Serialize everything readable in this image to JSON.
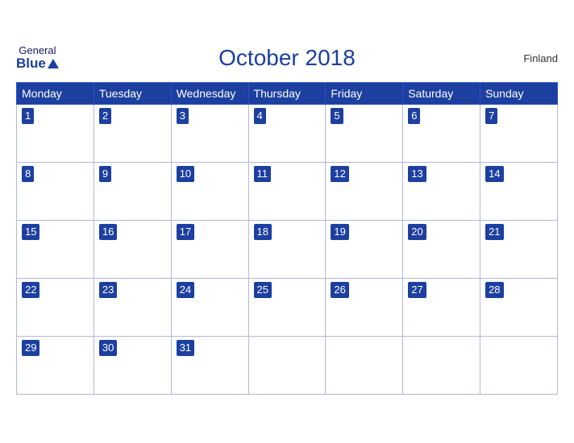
{
  "header": {
    "logo_general": "General",
    "logo_blue": "Blue",
    "title": "October 2018",
    "country": "Finland"
  },
  "weekdays": [
    "Monday",
    "Tuesday",
    "Wednesday",
    "Thursday",
    "Friday",
    "Saturday",
    "Sunday"
  ],
  "weeks": [
    [
      {
        "day": 1,
        "empty": false
      },
      {
        "day": 2,
        "empty": false
      },
      {
        "day": 3,
        "empty": false
      },
      {
        "day": 4,
        "empty": false
      },
      {
        "day": 5,
        "empty": false
      },
      {
        "day": 6,
        "empty": false
      },
      {
        "day": 7,
        "empty": false
      }
    ],
    [
      {
        "day": 8,
        "empty": false
      },
      {
        "day": 9,
        "empty": false
      },
      {
        "day": 10,
        "empty": false
      },
      {
        "day": 11,
        "empty": false
      },
      {
        "day": 12,
        "empty": false
      },
      {
        "day": 13,
        "empty": false
      },
      {
        "day": 14,
        "empty": false
      }
    ],
    [
      {
        "day": 15,
        "empty": false
      },
      {
        "day": 16,
        "empty": false
      },
      {
        "day": 17,
        "empty": false
      },
      {
        "day": 18,
        "empty": false
      },
      {
        "day": 19,
        "empty": false
      },
      {
        "day": 20,
        "empty": false
      },
      {
        "day": 21,
        "empty": false
      }
    ],
    [
      {
        "day": 22,
        "empty": false
      },
      {
        "day": 23,
        "empty": false
      },
      {
        "day": 24,
        "empty": false
      },
      {
        "day": 25,
        "empty": false
      },
      {
        "day": 26,
        "empty": false
      },
      {
        "day": 27,
        "empty": false
      },
      {
        "day": 28,
        "empty": false
      }
    ],
    [
      {
        "day": 29,
        "empty": false
      },
      {
        "day": 30,
        "empty": false
      },
      {
        "day": 31,
        "empty": false
      },
      {
        "day": null,
        "empty": true
      },
      {
        "day": null,
        "empty": true
      },
      {
        "day": null,
        "empty": true
      },
      {
        "day": null,
        "empty": true
      }
    ]
  ]
}
